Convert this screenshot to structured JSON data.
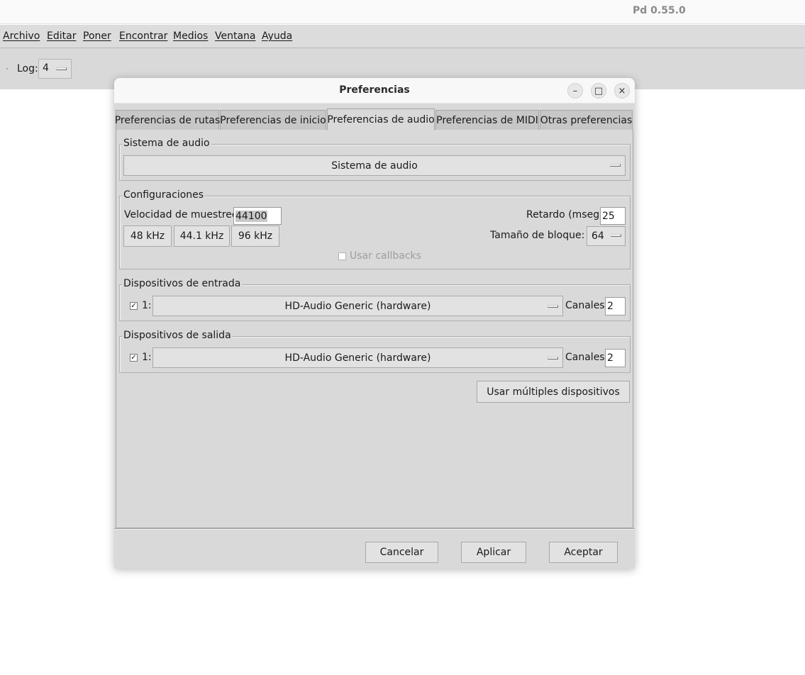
{
  "window": {
    "app_title": "Pd 0.55.0"
  },
  "menubar": {
    "items": [
      {
        "label": "Archivo"
      },
      {
        "label": "Editar"
      },
      {
        "label": "Poner"
      },
      {
        "label": "Encontrar"
      },
      {
        "label": "Medios"
      },
      {
        "label": "Ventana"
      },
      {
        "label": "Ayuda"
      }
    ]
  },
  "toolbar": {
    "log_label": "Log:",
    "log_value": "4"
  },
  "dialog": {
    "title": "Preferencias",
    "controls": {
      "minimize": "–",
      "maximize": "□",
      "close": "×"
    },
    "tabs": [
      {
        "label": "Preferencias de rutas"
      },
      {
        "label": "Preferencias de inicio"
      },
      {
        "label": "Preferencias de audio",
        "active": true
      },
      {
        "label": "Preferencias de MIDI"
      },
      {
        "label": "Otras preferencias"
      }
    ],
    "audio_system": {
      "group_label": "Sistema de audio",
      "selected": "Sistema de audio"
    },
    "settings": {
      "group_label": "Configuraciones",
      "sample_rate_label": "Velocidad de muestreo:",
      "sample_rate_value": "44100",
      "rate_buttons": [
        "48 kHz",
        "44.1 kHz",
        "96 kHz"
      ],
      "delay_label": "Retardo (mseg):",
      "delay_value": "25",
      "block_size_label": "Tamaño de bloque:",
      "block_size_value": "64",
      "callbacks_label": "Usar callbacks",
      "callbacks_checked": false
    },
    "input_devices": {
      "group_label": "Dispositivos de entrada",
      "index_label": "1:",
      "checked": true,
      "check_mark": "✓",
      "device": "HD-Audio Generic (hardware)",
      "channels_label": "Canales:",
      "channels_value": "2"
    },
    "output_devices": {
      "group_label": "Dispositivos de salida",
      "index_label": "1:",
      "checked": true,
      "check_mark": "✓",
      "device": "HD-Audio Generic (hardware)",
      "channels_label": "Canales:",
      "channels_value": "2"
    },
    "multi_devices_button": "Usar múltiples dispositivos",
    "buttons": {
      "cancel": "Cancelar",
      "apply": "Aplicar",
      "accept": "Aceptar"
    }
  }
}
